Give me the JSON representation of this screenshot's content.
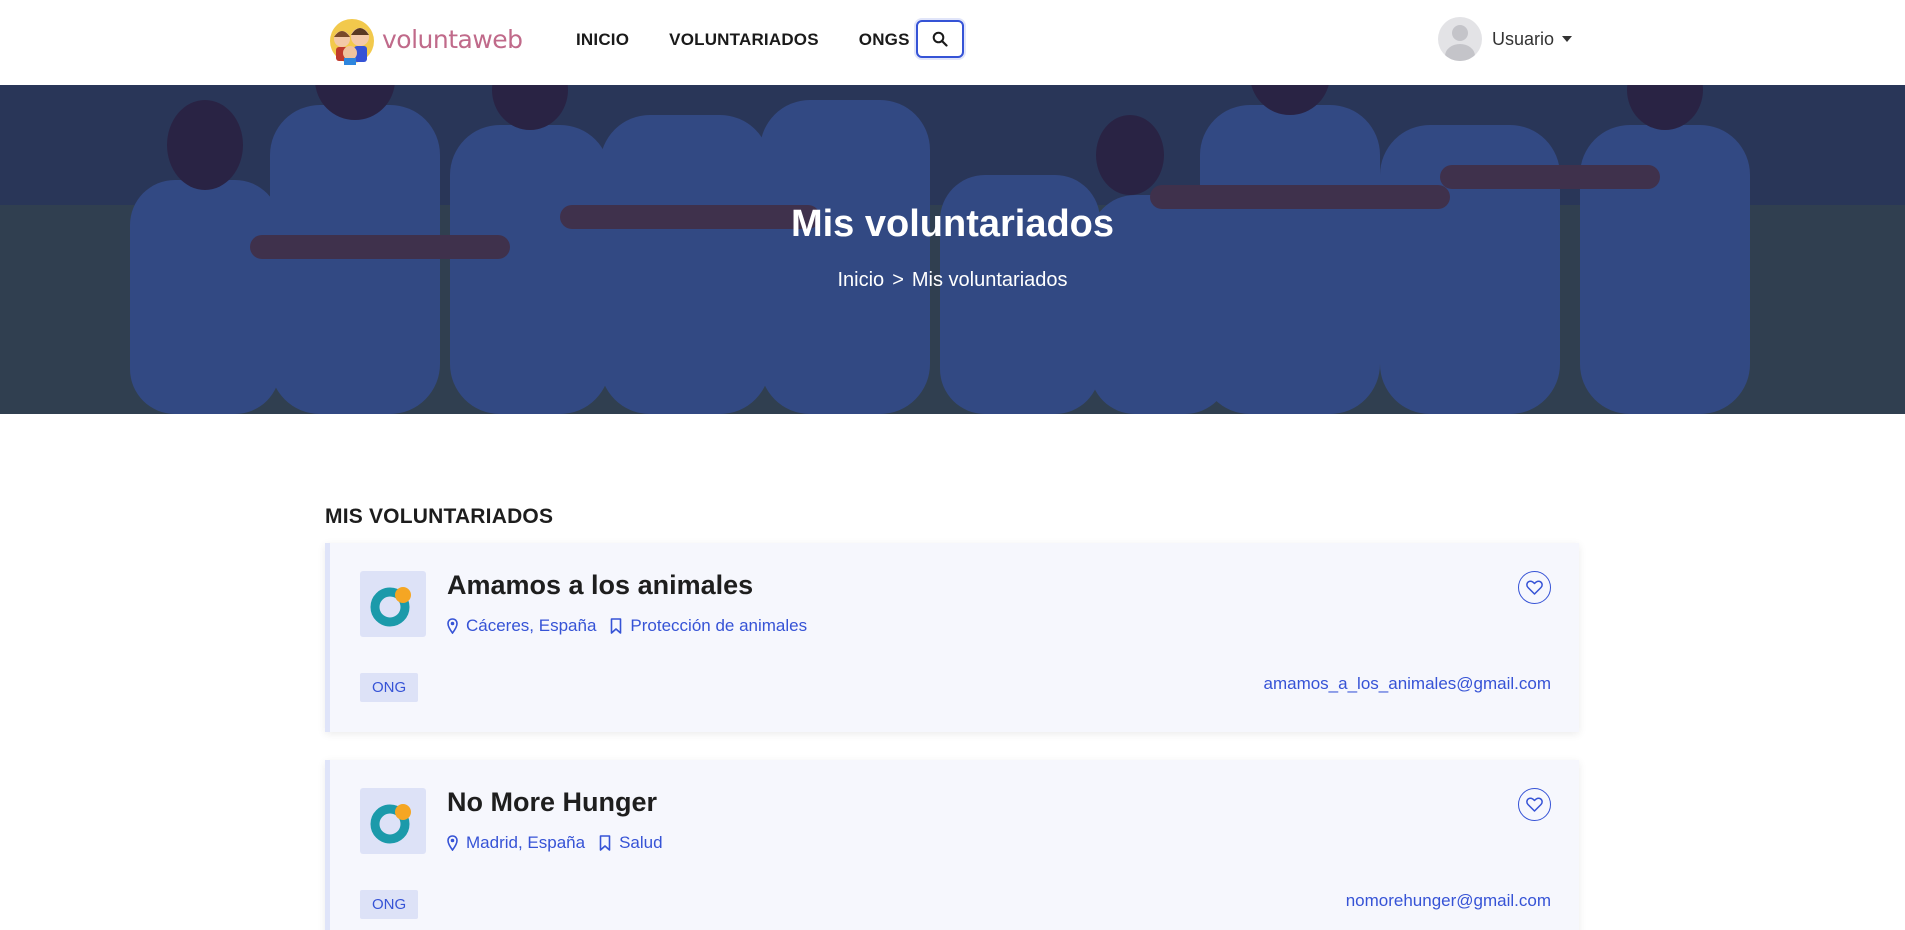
{
  "brand": {
    "name": "voluntaweb",
    "logo_icon": "volunteers-faces-logo"
  },
  "nav": {
    "items": [
      {
        "label": "INICIO"
      },
      {
        "label": "VOLUNTARIADOS"
      },
      {
        "label": "ONGS"
      }
    ],
    "search_icon": "search-icon"
  },
  "user": {
    "label": "Usuario",
    "avatar_icon": "user-avatar-icon"
  },
  "hero": {
    "title": "Mis voluntariados",
    "breadcrumb": {
      "home": "Inicio",
      "separator": ">",
      "current": "Mis voluntariados"
    }
  },
  "section": {
    "title": "MIS VOLUNTARIADOS"
  },
  "cards": [
    {
      "title": "Amamos a los animales",
      "location": "Cáceres, España",
      "category": "Protección de animales",
      "badge": "ONG",
      "email": "amamos_a_los_animales@gmail.com"
    },
    {
      "title": "No More Hunger",
      "location": "Madrid, España",
      "category": "Salud",
      "badge": "ONG",
      "email": "nomorehunger@gmail.com"
    }
  ],
  "colors": {
    "accent": "#3653d6",
    "card_bg": "#f6f7fd",
    "badge_bg": "#dde2f7",
    "logo_teal": "#1b9aaa",
    "logo_orange": "#f5a623"
  }
}
